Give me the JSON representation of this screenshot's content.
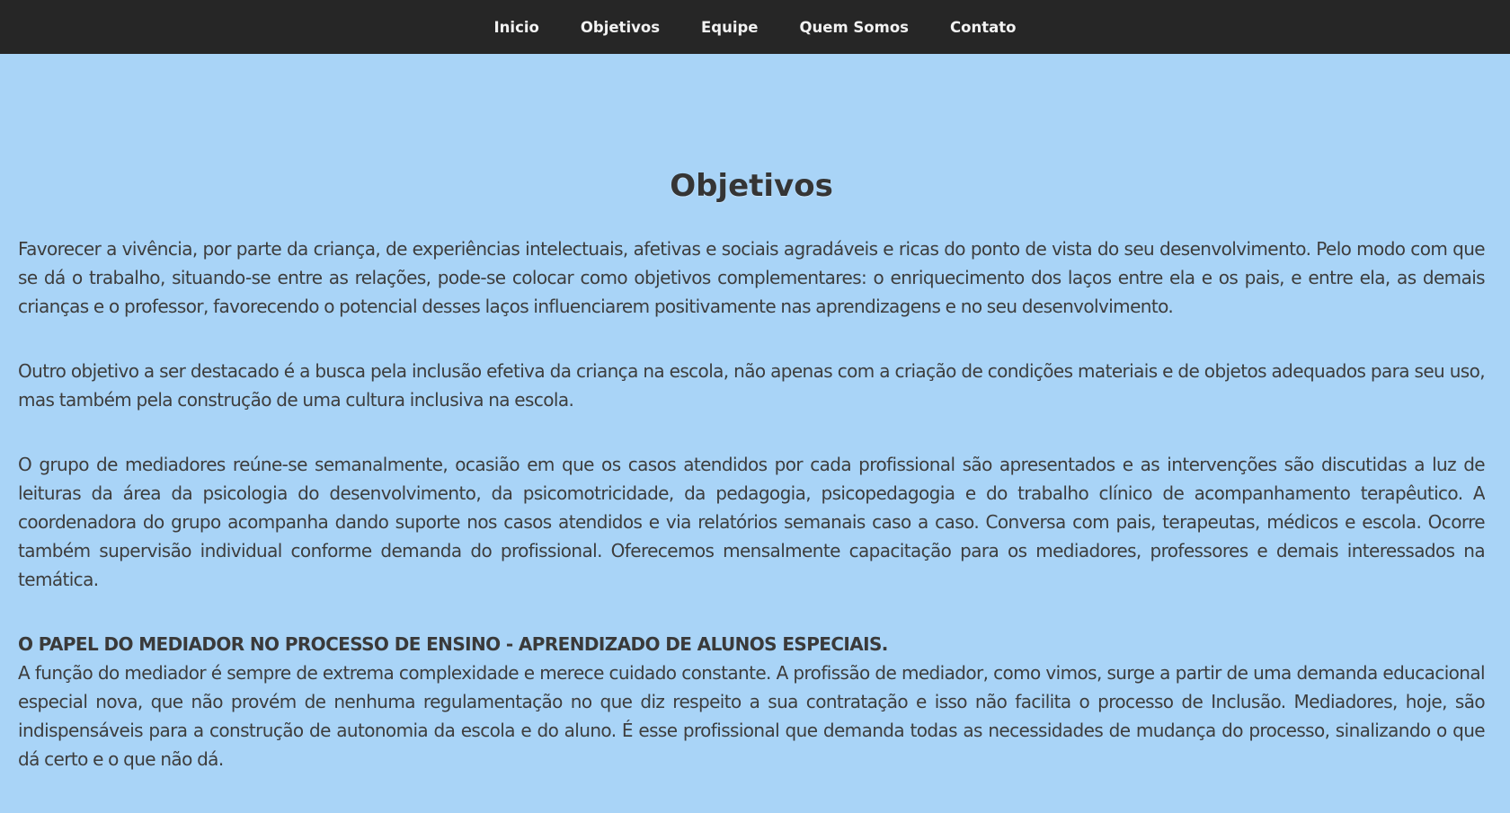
{
  "nav": {
    "items": [
      "Inicio",
      "Objetivos",
      "Equipe",
      "Quem Somos",
      "Contato"
    ]
  },
  "main": {
    "title": "Objetivos",
    "paragraphs": [
      "Favorecer a vivência, por parte da criança, de experiências intelectuais, afetivas e sociais agradáveis e ricas do ponto de vista do seu desenvolvimento. Pelo modo com que se dá o trabalho, situando-se entre as relações, pode-se colocar como objetivos complementares: o enriquecimento dos laços entre ela e os pais, e entre ela, as demais crianças e o professor, favorecendo o potencial desses laços influenciarem positivamente nas aprendizagens e no seu desenvolvimento.",
      "Outro objetivo a ser destacado é a busca pela inclusão efetiva da criança na escola, não apenas com a criação de condições materiais e de objetos adequados para seu uso, mas também pela construção de uma cultura inclusiva na escola.",
      "O grupo de mediadores reúne-se semanalmente, ocasião em que os casos atendidos por cada profissional são apresentados e as intervenções são discutidas a luz de leituras da área da psicologia do desenvolvimento, da psicomotricidade, da pedagogia, psicopedagogia e do trabalho clínico de acompanhamento terapêutico. A coordenadora do grupo acompanha dando suporte nos casos atendidos e via relatórios semanais caso a caso. Conversa com pais, terapeutas, médicos e escola. Ocorre também supervisão individual conforme demanda do profissional. Oferecemos mensalmente capacitação para os mediadores, professores e demais interessados na temática."
    ],
    "subheading": "O PAPEL DO MEDIADOR NO PROCESSO DE ENSINO - APRENDIZADO DE ALUNOS ESPECIAIS.",
    "final_paragraph": "A função do mediador é sempre de extrema complexidade e merece cuidado constante. A profissão de mediador, como vimos, surge a partir de uma demanda educacional especial nova, que não provém de nenhuma regulamentação no que diz respeito a sua contratação e isso não facilita o processo de Inclusão. Mediadores, hoje, são indispensáveis para a construção de autonomia da escola e do aluno. É esse profissional que demanda todas as necessidades de mudança do processo, sinalizando o que dá certo e o que não dá."
  },
  "colors": {
    "nav_background": "#262626",
    "nav_text": "#f2f2f2",
    "page_background": "#a9d4f7",
    "body_text": "#3d3d3d"
  }
}
